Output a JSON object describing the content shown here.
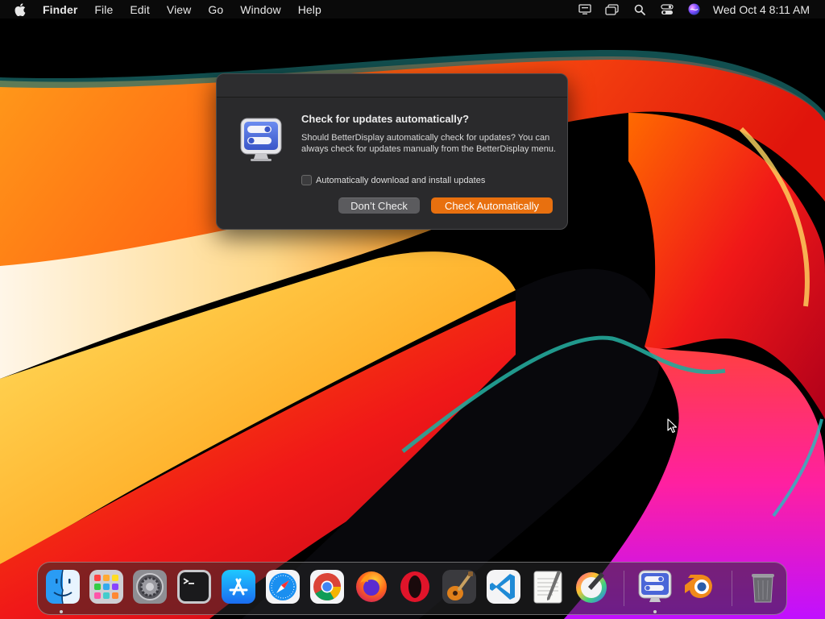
{
  "menubar": {
    "app_name": "Finder",
    "items": [
      "File",
      "Edit",
      "View",
      "Go",
      "Window",
      "Help"
    ],
    "clock": "Wed Oct 4  8:11 AM",
    "status_icons": [
      "display-icon",
      "stage-manager-icon",
      "search-icon",
      "control-center-icon",
      "siri-icon"
    ]
  },
  "dialog": {
    "heading": "Check for updates automatically?",
    "message": "Should BetterDisplay automatically check for updates? You can always check for updates manually from the BetterDisplay menu.",
    "checkbox_label": "Automatically download and install updates",
    "checkbox_checked": false,
    "secondary_button": "Don’t Check",
    "primary_button": "Check Automatically",
    "accent_color": "#e8700f"
  },
  "dock": {
    "apps": [
      "Finder",
      "Launchpad",
      "System Settings",
      "Terminal",
      "App Store",
      "Safari",
      "Chrome",
      "Firefox",
      "Opera",
      "GarageBand",
      "Visual Studio Code",
      "TextEdit",
      "Pixelmator",
      "BetterDisplay",
      "Blender",
      "Trash"
    ]
  }
}
